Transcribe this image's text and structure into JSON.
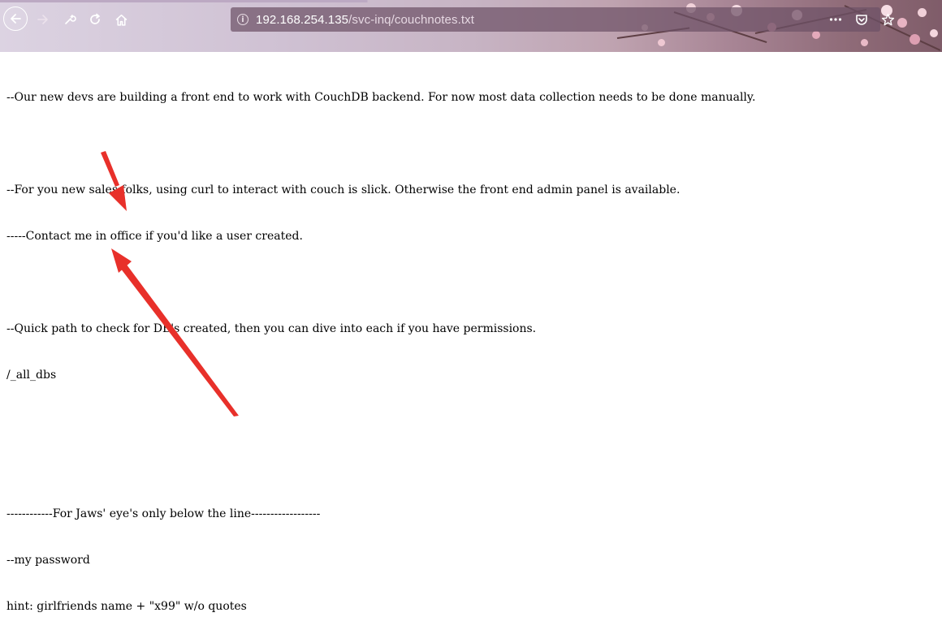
{
  "browser": {
    "url_host": "192.168.254.135",
    "url_path": "/svc-inq/couchnotes.txt",
    "icons": {
      "back": "back-arrow-icon",
      "forward": "forward-arrow-icon",
      "tools": "wrench-icon",
      "reload": "reload-icon",
      "home": "home-icon",
      "info": "info-icon",
      "more": "more-dots-icon",
      "pocket": "pocket-icon",
      "bookmark": "star-icon"
    }
  },
  "document": {
    "lines": [
      "--Our new devs are building a front end to work with CouchDB backend. For now most data collection needs to be done manually.",
      "",
      "--For you new sales folks, using curl to interact with couch is slick. Otherwise the front end admin panel is available.",
      "-----Contact me in office if you'd like a user created.",
      "",
      "--Quick path to check for DB's created, then you can dive into each if you have permissions.",
      "/_all_dbs",
      "",
      "",
      "------------For Jaws' eye's only below the line------------------",
      "--my password",
      "hint: girlfriends name + \"x99\" w/o quotes"
    ]
  },
  "annotations": {
    "arrow_color": "#e8302a"
  }
}
